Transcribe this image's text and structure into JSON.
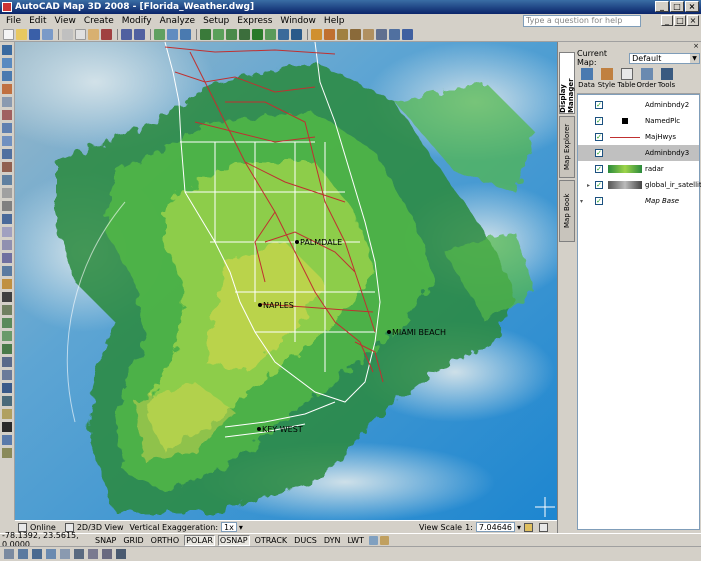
{
  "window": {
    "title": "AutoCAD Map 3D 2008 - [Florida_Weather.dwg]",
    "controls": [
      "_",
      "□",
      "×"
    ],
    "doc_controls": [
      "_",
      "□",
      "×"
    ]
  },
  "menu": {
    "items": [
      "File",
      "Edit",
      "View",
      "Create",
      "Modify",
      "Analyze",
      "Setup",
      "Express",
      "Window",
      "Help"
    ],
    "help_placeholder": "Type a question for help"
  },
  "map": {
    "cities": [
      {
        "name": "PALMDALE"
      },
      {
        "name": "NAPLES"
      },
      {
        "name": "MIAMI BEACH"
      },
      {
        "name": "KEY WEST"
      }
    ],
    "colors": {
      "ocean": "#2f8fd0",
      "cloud": "#c6d8e0",
      "radar_dark": "#2b8a3c",
      "radar_mid": "#52b848",
      "radar_light": "#9dd44a",
      "radar_yellow": "#e0d850",
      "roads": "#c03030",
      "boundaries": "#ffffff"
    }
  },
  "map_status": {
    "online_label": "Online",
    "view_label": "2D/3D View",
    "vexag_label": "Vertical Exaggeration:",
    "vexag_value": "1x",
    "scale_label": "View Scale",
    "scale_prefix": "1:",
    "scale_value": "7.04646"
  },
  "panel": {
    "current_map_label": "Current Map:",
    "current_map_value": "Default",
    "tabs": [
      "Display Manager",
      "Map Explorer",
      "Map Book"
    ],
    "tools": [
      "Data",
      "Style",
      "Table",
      "Order",
      "Tools"
    ],
    "layers": [
      {
        "name": "Adminbndy2",
        "checked": true,
        "selected": false
      },
      {
        "name": "NamedPlc",
        "checked": true,
        "selected": false
      },
      {
        "name": "MajHwys",
        "checked": true,
        "selected": false
      },
      {
        "name": "Adminbndy3",
        "checked": true,
        "selected": true
      },
      {
        "name": "radar",
        "checked": true,
        "selected": false
      },
      {
        "name": "global_ir_satellit",
        "checked": true,
        "selected": false
      },
      {
        "name": "Map Base",
        "checked": true,
        "selected": false
      }
    ]
  },
  "statusbar": {
    "coords": "-78.1392, 23.5615, 0.0000",
    "buttons": [
      {
        "label": "SNAP",
        "on": false
      },
      {
        "label": "GRID",
        "on": false
      },
      {
        "label": "ORTHO",
        "on": false
      },
      {
        "label": "POLAR",
        "on": true
      },
      {
        "label": "OSNAP",
        "on": true
      },
      {
        "label": "OTRACK",
        "on": false
      },
      {
        "label": "DUCS",
        "on": false
      },
      {
        "label": "DYN",
        "on": false
      },
      {
        "label": "LWT",
        "on": false
      }
    ]
  }
}
